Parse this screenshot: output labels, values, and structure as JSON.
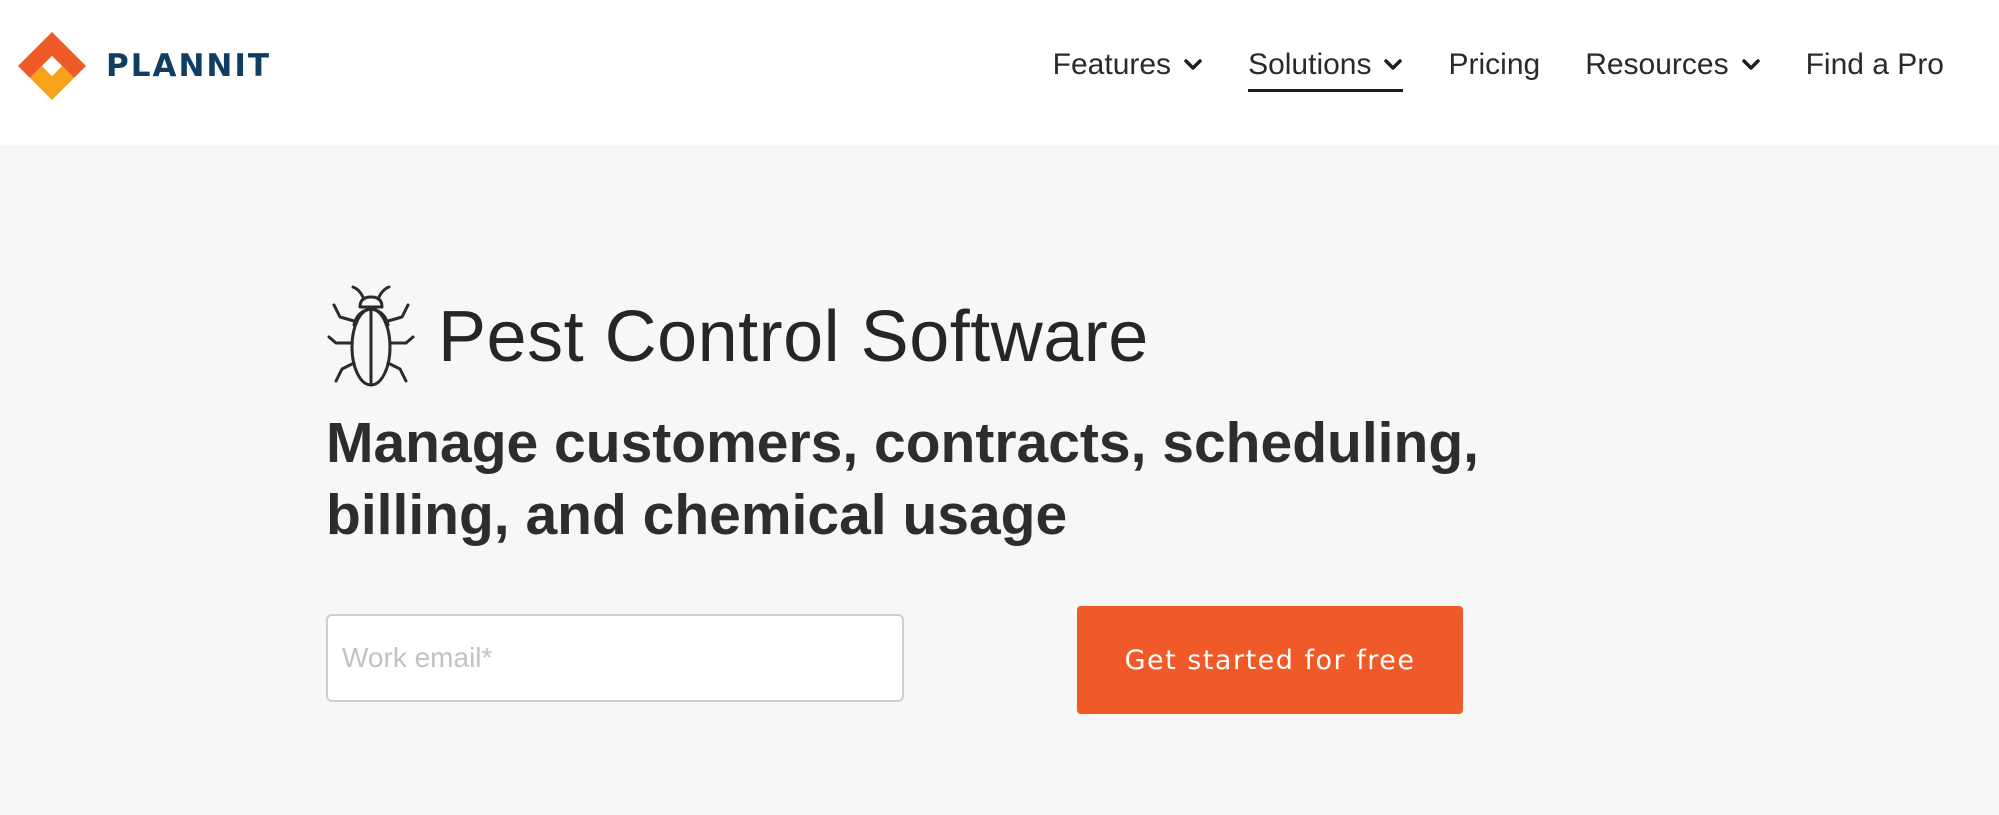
{
  "header": {
    "logo": {
      "icon": "plannit-diamond-logo",
      "text": "PLANNIT",
      "colors": {
        "orange": "#f05a28",
        "yellow": "#f7a21b",
        "navy": "#123d63"
      }
    },
    "nav": [
      {
        "label": "Features",
        "has_dropdown": true,
        "active": false
      },
      {
        "label": "Solutions",
        "has_dropdown": true,
        "active": true
      },
      {
        "label": "Pricing",
        "has_dropdown": false,
        "active": false
      },
      {
        "label": "Resources",
        "has_dropdown": true,
        "active": false
      },
      {
        "label": "Find a Pro",
        "has_dropdown": false,
        "active": false
      }
    ]
  },
  "hero": {
    "icon": "bug-icon",
    "title": "Pest Control Software",
    "subtitle": "Manage customers, contracts, scheduling, billing, and chemical usage",
    "email_input": {
      "value": "",
      "placeholder": "Work email*"
    },
    "cta_label": "Get started for free",
    "colors": {
      "background": "#f7f7f7",
      "cta": "#f05a28"
    }
  }
}
